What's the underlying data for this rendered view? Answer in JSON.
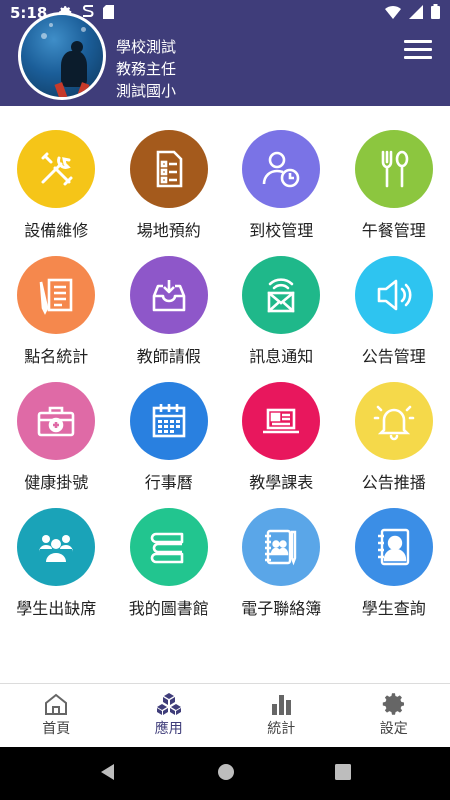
{
  "status_bar": {
    "time": "5:18",
    "icons_left": [
      "gear-icon",
      "s-app-icon",
      "sd-card-icon"
    ],
    "icons_right": [
      "wifi-icon",
      "signal-icon",
      "battery-icon"
    ]
  },
  "header": {
    "school_name": "學校測試",
    "role": "教務主任",
    "school_unit": "測試國小",
    "background": "#3f3d7a"
  },
  "apps": [
    {
      "label": "設備維修",
      "icon": "tools-icon",
      "color": "#f5c518"
    },
    {
      "label": "場地預約",
      "icon": "checklist-icon",
      "color": "#a45a1c"
    },
    {
      "label": "到校管理",
      "icon": "user-clock-icon",
      "color": "#7a73e6"
    },
    {
      "label": "午餐管理",
      "icon": "fork-spoon-icon",
      "color": "#8cc63f"
    },
    {
      "label": "點名統計",
      "icon": "roll-call-icon",
      "color": "#f5884d"
    },
    {
      "label": "教師請假",
      "icon": "inbox-icon",
      "color": "#8e57c9"
    },
    {
      "label": "訊息通知",
      "icon": "message-icon",
      "color": "#1fb88a"
    },
    {
      "label": "公告管理",
      "icon": "speaker-icon",
      "color": "#2ec4f0"
    },
    {
      "label": "健康掛號",
      "icon": "medical-kit-icon",
      "color": "#df6aa6"
    },
    {
      "label": "行事曆",
      "icon": "calendar-icon",
      "color": "#2980e0"
    },
    {
      "label": "教學課表",
      "icon": "laptop-icon",
      "color": "#e8175d"
    },
    {
      "label": "公告推播",
      "icon": "bell-icon",
      "color": "#f5d94a"
    },
    {
      "label": "學生出缺席",
      "icon": "students-icon",
      "color": "#1aa3b8"
    },
    {
      "label": "我的圖書館",
      "icon": "books-icon",
      "color": "#22c58f"
    },
    {
      "label": "電子聯絡簿",
      "icon": "contact-book-icon",
      "color": "#5aa6e8"
    },
    {
      "label": "學生查詢",
      "icon": "student-profile-icon",
      "color": "#3b8ee6"
    }
  ],
  "bottom_nav": [
    {
      "label": "首頁",
      "icon": "home-icon",
      "active": false
    },
    {
      "label": "應用",
      "icon": "apps-cube-icon",
      "active": true
    },
    {
      "label": "統計",
      "icon": "bar-chart-icon",
      "active": false
    },
    {
      "label": "設定",
      "icon": "settings-icon",
      "active": false
    }
  ],
  "accent_color": "#3f3d7a"
}
